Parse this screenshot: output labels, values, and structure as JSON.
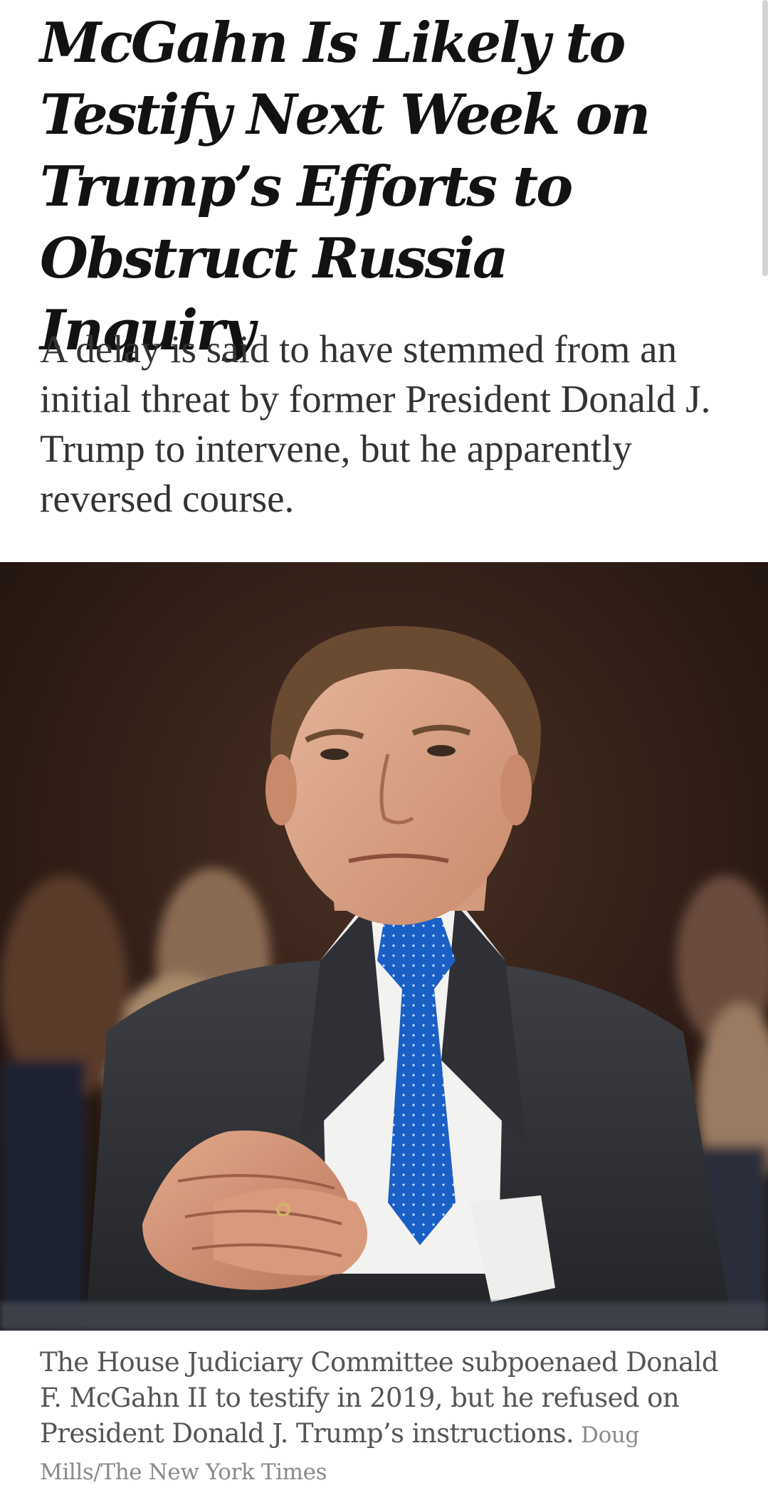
{
  "article": {
    "headline": "McGahn Is Likely to Testify Next Week on Trump’s Efforts to Obstruct Russia Inquiry",
    "summary": "A delay is said to have stemmed from an initial threat by former President Donald J. Trump to intervene, but he apparently reversed course.",
    "photo": {
      "caption": "The House Judiciary Committee subpoenaed Donald F. McGahn II to testify in 2019, but he refused on President Donald J. Trump’s instructions.",
      "credit": "Doug Mills/The New York Times"
    }
  },
  "colors": {
    "headline": "#121212",
    "summary": "#333333",
    "caption": "#555555",
    "credit": "#8a8a8a",
    "tie": "#1a5fc4"
  }
}
